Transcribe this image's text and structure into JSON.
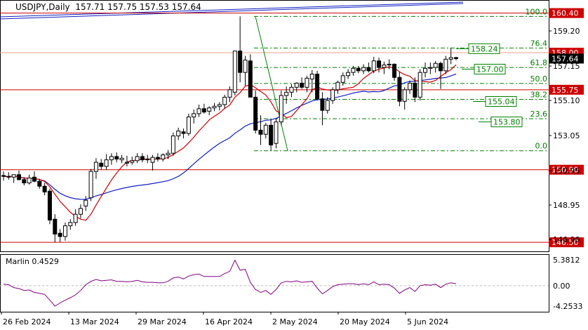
{
  "header": {
    "symbol_tf": "USDJPY,Daily",
    "ohlc": "157.71 157.75 157.53 157.64"
  },
  "indicator": {
    "label": "Marlin 0.4529",
    "ticks": [
      "5.3812",
      "0.00",
      "-4.2533"
    ]
  },
  "colors": {
    "bull": "#000000",
    "bear": "#000000",
    "ma_fast": "#cc0000",
    "ma_slow": "#1020c0",
    "fib": "#008000",
    "hline": "#cc0000",
    "marlin": "#800080",
    "channel": "#1020c0"
  },
  "chart_data": {
    "type": "candlestick",
    "price_range": [
      145.95,
      161.15
    ],
    "y_ticks": [
      "159.20",
      "157.15",
      "155.10",
      "153.05",
      "150.95",
      "148.95",
      "146.90"
    ],
    "x_ticks": [
      "26 Feb 2024",
      "13 Mar 2024",
      "29 Mar 2024",
      "16 Apr 2024",
      "2 May 2024",
      "20 May 2024",
      "5 Jun 2024"
    ],
    "current_price": "157.64",
    "levels": [
      {
        "label": "160.40",
        "price": 160.4
      },
      {
        "label": "158.00",
        "price": 158.0
      },
      {
        "label": "155.75",
        "price": 155.75
      },
      {
        "label": "150.90",
        "price": 150.9
      },
      {
        "label": "146.50",
        "price": 146.5
      }
    ],
    "fib_levels": [
      {
        "pct": "100.0",
        "price": 160.2
      },
      {
        "pct": "76.4",
        "price": 158.28
      },
      {
        "pct": "61.8",
        "price": 157.1
      },
      {
        "pct": "50.0",
        "price": 156.13
      },
      {
        "pct": "38.2",
        "price": 155.17
      },
      {
        "pct": "23.6",
        "price": 153.99
      },
      {
        "pct": "0.0",
        "price": 152.05
      }
    ],
    "price_boxes": [
      {
        "label": "158.24",
        "price": 158.24
      },
      {
        "label": "157.00",
        "price": 157.0
      },
      {
        "label": "155.04",
        "price": 155.04
      },
      {
        "label": "153.80",
        "price": 153.8
      }
    ],
    "candles": [
      [
        150.55,
        150.8,
        150.25,
        150.5
      ],
      [
        150.5,
        150.75,
        150.3,
        150.45
      ],
      [
        150.45,
        150.6,
        150.1,
        150.6
      ],
      [
        150.6,
        150.85,
        150.25,
        150.3
      ],
      [
        150.3,
        150.45,
        149.95,
        150.1
      ],
      [
        150.1,
        150.6,
        150.0,
        150.4
      ],
      [
        150.45,
        150.8,
        150.15,
        150.2
      ],
      [
        150.2,
        150.35,
        149.75,
        149.9
      ],
      [
        149.9,
        150.1,
        149.35,
        149.55
      ],
      [
        149.6,
        149.75,
        147.6,
        147.85
      ],
      [
        147.9,
        148.2,
        146.5,
        147.0
      ],
      [
        147.05,
        147.3,
        146.5,
        146.85
      ],
      [
        146.85,
        147.7,
        146.6,
        147.5
      ],
      [
        147.5,
        147.9,
        147.25,
        147.7
      ],
      [
        147.7,
        148.5,
        147.5,
        148.2
      ],
      [
        148.2,
        148.8,
        147.95,
        148.55
      ],
      [
        148.7,
        149.3,
        148.4,
        149.05
      ],
      [
        149.2,
        150.95,
        149.0,
        150.8
      ],
      [
        150.8,
        151.6,
        150.35,
        151.35
      ],
      [
        151.3,
        151.55,
        150.9,
        151.1
      ],
      [
        151.1,
        151.85,
        150.9,
        151.5
      ],
      [
        151.5,
        151.9,
        151.2,
        151.7
      ],
      [
        151.7,
        151.95,
        151.35,
        151.55
      ],
      [
        151.5,
        151.8,
        151.3,
        151.6
      ],
      [
        151.3,
        151.75,
        151.1,
        151.35
      ],
      [
        151.35,
        151.7,
        151.2,
        151.45
      ],
      [
        151.45,
        151.9,
        151.3,
        151.7
      ],
      [
        151.7,
        151.9,
        151.35,
        151.5
      ],
      [
        151.5,
        151.8,
        151.3,
        151.55
      ],
      [
        151.35,
        151.8,
        150.85,
        151.65
      ],
      [
        151.65,
        151.9,
        151.4,
        151.55
      ],
      [
        151.55,
        151.9,
        151.4,
        151.8
      ],
      [
        151.8,
        152.1,
        151.55,
        151.9
      ],
      [
        151.9,
        153.15,
        151.75,
        152.95
      ],
      [
        152.95,
        153.45,
        152.7,
        153.25
      ],
      [
        153.2,
        153.4,
        152.8,
        153.1
      ],
      [
        153.1,
        154.3,
        152.95,
        154.1
      ],
      [
        154.1,
        154.55,
        153.7,
        154.3
      ],
      [
        154.3,
        154.85,
        154.1,
        154.6
      ],
      [
        154.6,
        154.9,
        154.3,
        154.4
      ],
      [
        154.45,
        154.75,
        154.2,
        154.65
      ],
      [
        154.65,
        154.95,
        154.45,
        154.75
      ],
      [
        154.75,
        155.0,
        154.5,
        154.85
      ],
      [
        154.85,
        155.45,
        154.6,
        155.3
      ],
      [
        155.3,
        155.95,
        155.0,
        155.75
      ],
      [
        155.6,
        158.1,
        155.4,
        158.1
      ],
      [
        158.1,
        160.2,
        156.2,
        156.8
      ],
      [
        156.8,
        157.8,
        156.0,
        157.55
      ],
      [
        157.5,
        157.9,
        155.7,
        155.3
      ],
      [
        155.3,
        155.7,
        153.1,
        153.3
      ],
      [
        153.3,
        154.2,
        152.4,
        153.05
      ],
      [
        153.05,
        153.75,
        152.8,
        153.6
      ],
      [
        153.6,
        153.95,
        152.05,
        152.4
      ],
      [
        152.5,
        154.0,
        152.2,
        153.8
      ],
      [
        153.8,
        155.7,
        153.6,
        155.4
      ],
      [
        155.4,
        155.95,
        154.9,
        155.6
      ],
      [
        155.6,
        156.1,
        155.3,
        155.9
      ],
      [
        155.9,
        156.2,
        155.6,
        156.15
      ],
      [
        156.15,
        156.5,
        155.8,
        155.9
      ],
      [
        155.9,
        156.6,
        155.6,
        156.45
      ],
      [
        156.4,
        156.95,
        155.6,
        156.7
      ],
      [
        156.7,
        156.9,
        155.1,
        155.2
      ],
      [
        155.2,
        155.6,
        153.6,
        154.5
      ],
      [
        154.5,
        155.3,
        154.3,
        155.1
      ],
      [
        155.1,
        155.9,
        154.9,
        155.75
      ],
      [
        155.75,
        156.3,
        155.5,
        156.2
      ],
      [
        156.2,
        156.8,
        156.0,
        156.6
      ],
      [
        156.6,
        157.0,
        156.4,
        156.8
      ],
      [
        156.8,
        157.2,
        156.6,
        157.05
      ],
      [
        157.05,
        157.2,
        156.75,
        156.9
      ],
      [
        156.9,
        157.3,
        156.7,
        157.1
      ],
      [
        157.1,
        157.4,
        156.8,
        156.9
      ],
      [
        156.9,
        157.75,
        156.75,
        157.5
      ],
      [
        157.5,
        157.7,
        156.8,
        157.1
      ],
      [
        157.1,
        157.45,
        156.7,
        157.25
      ],
      [
        157.25,
        157.6,
        157.0,
        157.3
      ],
      [
        157.3,
        157.35,
        156.3,
        156.5
      ],
      [
        156.5,
        156.85,
        154.75,
        155.05
      ],
      [
        155.05,
        155.9,
        154.55,
        155.75
      ],
      [
        155.75,
        156.3,
        155.5,
        156.15
      ],
      [
        156.15,
        156.5,
        155.0,
        155.3
      ],
      [
        155.3,
        157.0,
        155.1,
        156.8
      ],
      [
        156.8,
        157.4,
        156.5,
        157.05
      ],
      [
        157.05,
        157.4,
        156.7,
        157.1
      ],
      [
        157.1,
        157.5,
        156.8,
        157.35
      ],
      [
        157.35,
        157.45,
        155.8,
        156.9
      ],
      [
        156.9,
        157.8,
        156.7,
        157.6
      ],
      [
        157.6,
        158.3,
        157.3,
        157.7
      ],
      [
        157.7,
        157.75,
        157.53,
        157.64
      ]
    ],
    "marlin": [
      0.3,
      0.2,
      -0.4,
      -0.6,
      -1.0,
      -0.9,
      -1.4,
      -1.6,
      -1.8,
      -3.0,
      -4.25,
      -3.6,
      -3.0,
      -2.5,
      -1.9,
      -1.0,
      0.2,
      0.9,
      1.3,
      1.0,
      1.1,
      1.2,
      0.9,
      0.9,
      0.8,
      0.9,
      1.1,
      0.8,
      0.7,
      0.7,
      0.6,
      0.6,
      0.9,
      1.6,
      1.8,
      1.4,
      2.0,
      2.3,
      2.4,
      1.9,
      1.9,
      1.9,
      1.9,
      2.5,
      3.0,
      5.3,
      3.2,
      3.4,
      0.7,
      -0.8,
      -1.4,
      -1.0,
      -1.8,
      -0.8,
      0.6,
      0.9,
      0.8,
      1.0,
      0.7,
      0.8,
      0.9,
      -0.5,
      -1.7,
      -1.0,
      -0.2,
      0.2,
      0.3,
      0.4,
      0.4,
      0.2,
      0.4,
      0.2,
      0.8,
      0.2,
      0.3,
      0.2,
      -0.5,
      -1.6,
      -0.9,
      -0.4,
      -1.2,
      0.0,
      0.2,
      0.1,
      0.3,
      -0.4,
      0.3,
      0.6,
      0.4
    ]
  }
}
